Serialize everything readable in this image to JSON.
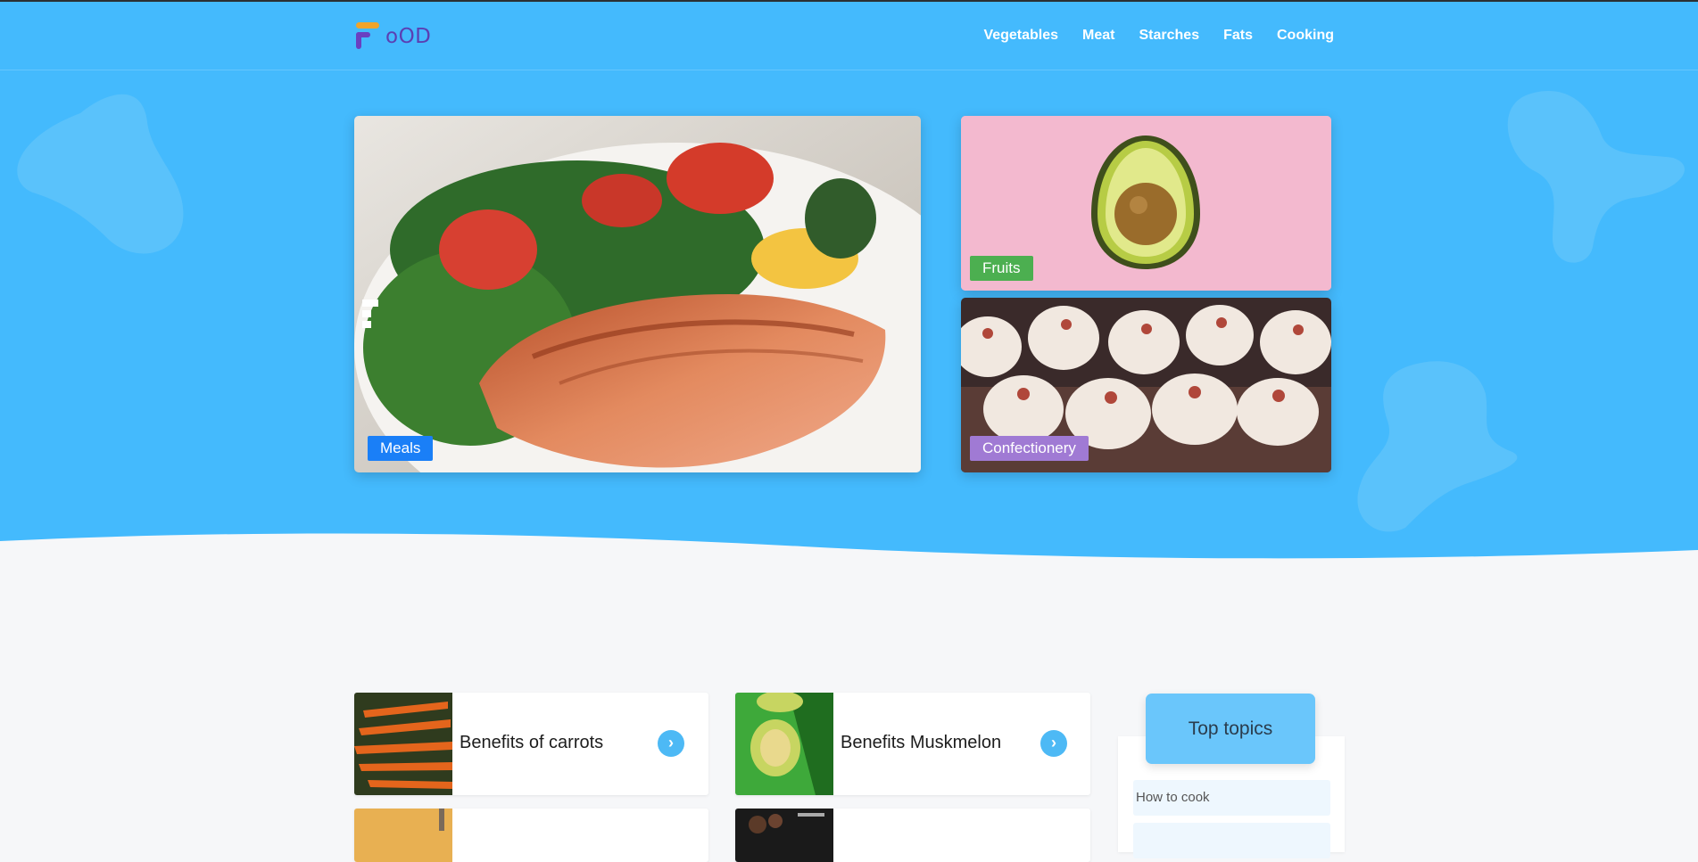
{
  "app": {
    "logo_text": "oOD",
    "brand_color": "#44bafd"
  },
  "nav": {
    "items": [
      "Vegetables",
      "Meat",
      "Starches",
      "Fats",
      "Cooking"
    ]
  },
  "hero": {
    "cards": [
      {
        "tag": "Meals",
        "tag_color": "#1a7ff7"
      },
      {
        "tag": "Fruits",
        "tag_color": "#4caf50"
      },
      {
        "tag": "Confectionery",
        "tag_color": "#a07ad4"
      }
    ]
  },
  "articles": [
    {
      "title": "Benefits of carrots"
    },
    {
      "title": "Benefits Muskmelon"
    }
  ],
  "sidebar": {
    "title": "Top topics",
    "items": [
      "How to cook"
    ]
  }
}
